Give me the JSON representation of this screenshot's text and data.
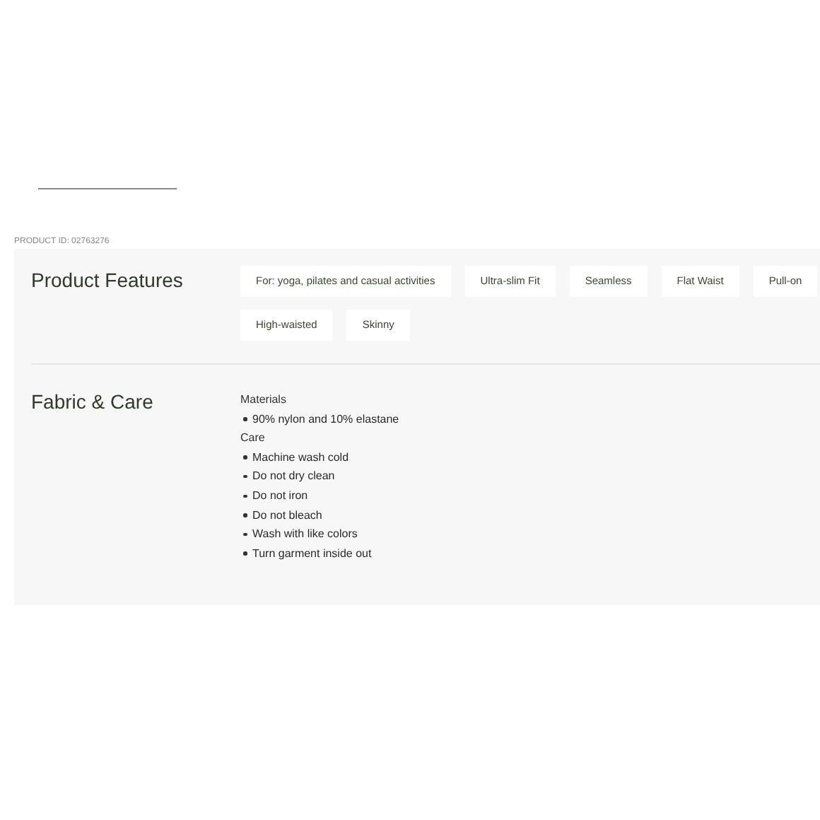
{
  "product_id": "PRODUCT ID: 02763276",
  "sections": [
    {
      "kind": "tags",
      "title": "Product Features",
      "tags": [
        "For: yoga, pilates and casual activities",
        "Ultra-slim Fit",
        "Seamless",
        "Flat Waist",
        "Pull-on",
        "High-waisted",
        "Skinny"
      ]
    },
    {
      "kind": "lists",
      "title": "Fabric & Care",
      "groups": [
        {
          "heading": "Materials",
          "items": [
            "90% nylon and 10% elastane"
          ]
        },
        {
          "heading": "Care",
          "items": [
            "Machine wash cold",
            "Do not dry clean",
            "Do not iron",
            "Do not bleach",
            "Wash with like colors",
            "Turn garment inside out"
          ]
        }
      ]
    }
  ]
}
